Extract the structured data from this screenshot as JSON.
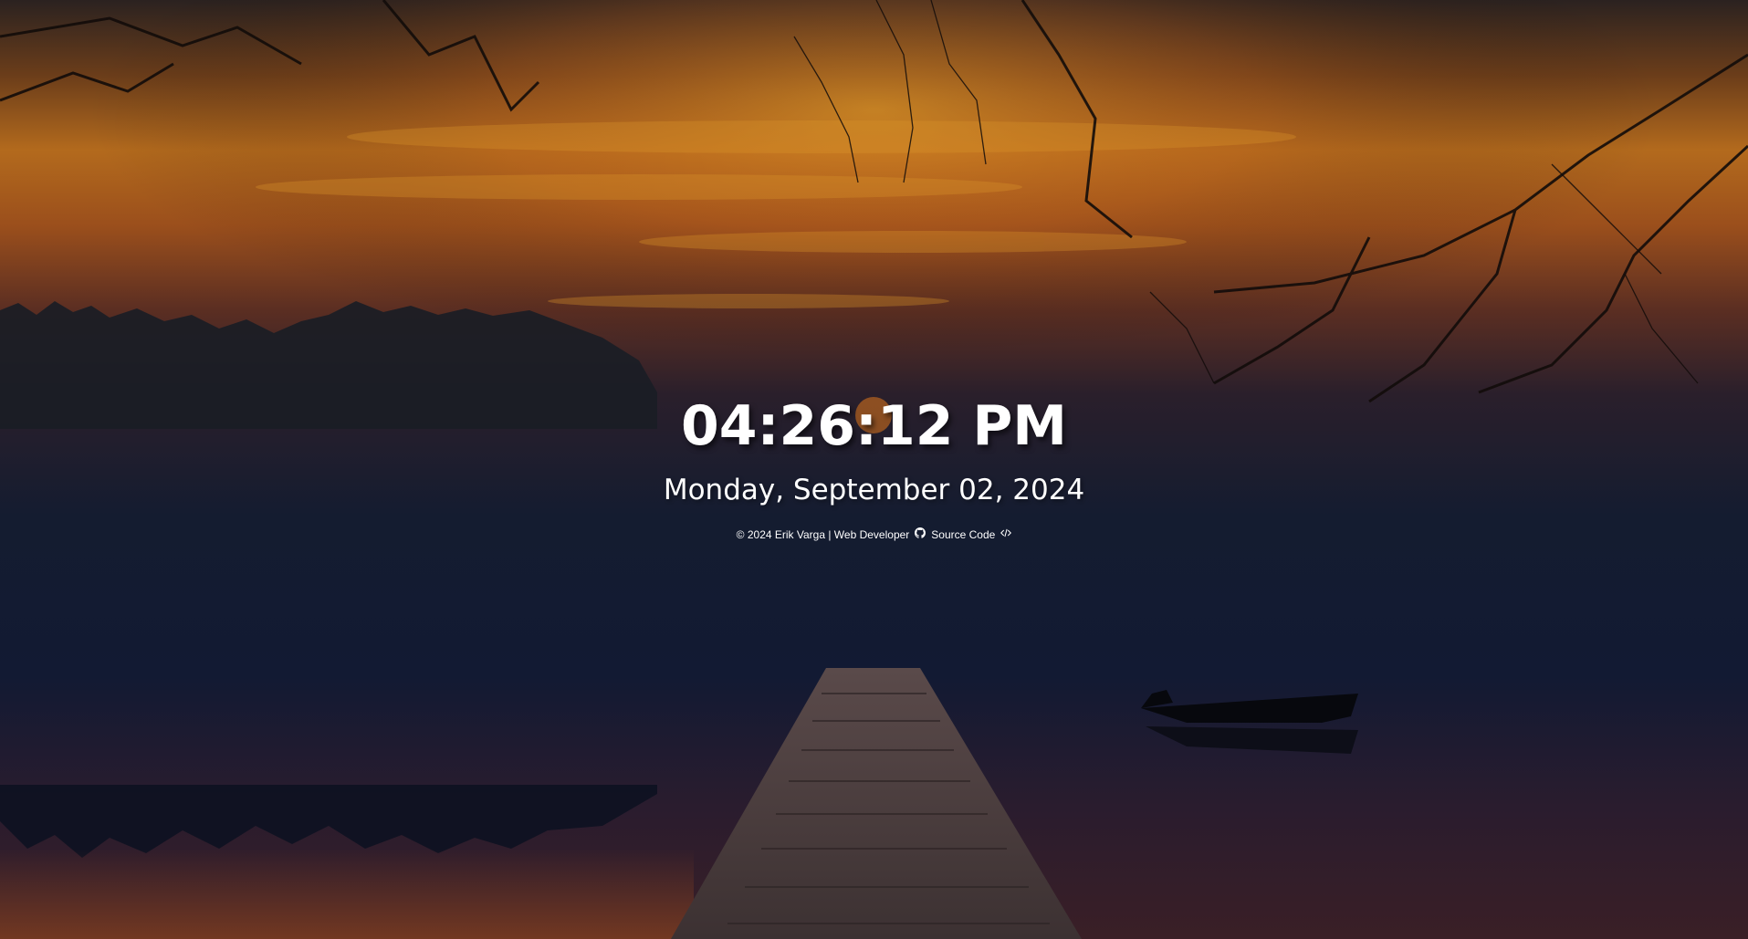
{
  "clock": {
    "time": "04:26:12 PM",
    "date": "Monday, September 02, 2024"
  },
  "footer": {
    "copyright": "© 2024 Erik Varga | Web Developer",
    "github_icon": "github-icon",
    "source_label": "Source Code",
    "code_icon": "code-icon"
  },
  "theme": {
    "text_color": "#ffffff",
    "sky_top": "#3a2a1a",
    "sky_glow": "#c7761f",
    "water": "#101a33"
  }
}
